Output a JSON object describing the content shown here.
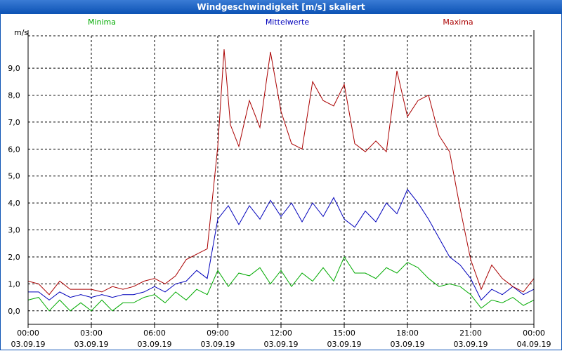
{
  "window": {
    "title": "Windgeschwindigkeit [m/s] skaliert"
  },
  "colors": {
    "min": "#00aa00",
    "mean": "#0000bb",
    "max": "#aa0000",
    "title_bg": "#0c52b4"
  },
  "chart_data": {
    "type": "line",
    "title": "Windgeschwindigkeit [m/s] skaliert",
    "ylabel": "m/s",
    "ylim": [
      -0.5,
      10.2
    ],
    "xlim": [
      0,
      24
    ],
    "grid": true,
    "legend_placement": "top",
    "y_ticks": [
      "0,0",
      "1,0",
      "2,0",
      "3,0",
      "4,0",
      "5,0",
      "6,0",
      "7,0",
      "8,0",
      "9,0"
    ],
    "x_ticks": [
      {
        "time": "00:00",
        "date": "03.09.19"
      },
      {
        "time": "03:00",
        "date": "03.09.19"
      },
      {
        "time": "06:00",
        "date": "03.09.19"
      },
      {
        "time": "09:00",
        "date": "03.09.19"
      },
      {
        "time": "12:00",
        "date": "03.09.19"
      },
      {
        "time": "15:00",
        "date": "03.09.19"
      },
      {
        "time": "18:00",
        "date": "03.09.19"
      },
      {
        "time": "21:00",
        "date": "03.09.19"
      },
      {
        "time": "00:00",
        "date": "04.09.19"
      }
    ],
    "series": [
      {
        "name": "Minima",
        "color": "#00aa00",
        "x": [
          0,
          0.5,
          1,
          1.5,
          2,
          2.5,
          3,
          3.5,
          4,
          4.5,
          5,
          5.5,
          6,
          6.5,
          7,
          7.5,
          8,
          8.5,
          9,
          9.5,
          10,
          10.5,
          11,
          11.5,
          12,
          12.5,
          13,
          13.5,
          14,
          14.5,
          15,
          15.5,
          16,
          16.5,
          17,
          17.5,
          18,
          18.5,
          19,
          19.5,
          20,
          20.5,
          21,
          21.5,
          22,
          22.5,
          23,
          23.5,
          24
        ],
        "values": [
          0.4,
          0.5,
          0.0,
          0.4,
          0.0,
          0.3,
          0.0,
          0.4,
          0.0,
          0.3,
          0.3,
          0.5,
          0.6,
          0.3,
          0.7,
          0.4,
          0.8,
          0.6,
          1.5,
          0.9,
          1.4,
          1.3,
          1.6,
          1.0,
          1.5,
          0.9,
          1.4,
          1.1,
          1.6,
          1.1,
          2.0,
          1.4,
          1.4,
          1.2,
          1.6,
          1.4,
          1.8,
          1.6,
          1.2,
          0.9,
          1.0,
          0.9,
          0.6,
          0.1,
          0.4,
          0.3,
          0.5,
          0.2,
          0.4
        ]
      },
      {
        "name": "Mittelwerte",
        "color": "#0000bb",
        "x": [
          0,
          0.5,
          1,
          1.5,
          2,
          2.5,
          3,
          3.5,
          4,
          4.5,
          5,
          5.5,
          6,
          6.5,
          7,
          7.5,
          8,
          8.5,
          9,
          9.5,
          10,
          10.5,
          11,
          11.5,
          12,
          12.5,
          13,
          13.5,
          14,
          14.5,
          15,
          15.5,
          16,
          16.5,
          17,
          17.5,
          18,
          18.5,
          19,
          19.5,
          20,
          20.5,
          21,
          21.5,
          22,
          22.5,
          23,
          23.5,
          24
        ],
        "values": [
          0.7,
          0.7,
          0.4,
          0.7,
          0.5,
          0.6,
          0.5,
          0.6,
          0.5,
          0.6,
          0.6,
          0.7,
          0.9,
          0.7,
          1.0,
          1.1,
          1.5,
          1.2,
          3.4,
          3.9,
          3.2,
          3.9,
          3.4,
          4.1,
          3.5,
          4.0,
          3.3,
          4.0,
          3.5,
          4.2,
          3.4,
          3.1,
          3.7,
          3.3,
          4.0,
          3.6,
          4.5,
          4.0,
          3.4,
          2.7,
          2.0,
          1.7,
          1.2,
          0.4,
          0.8,
          0.6,
          0.9,
          0.6,
          0.8
        ]
      },
      {
        "name": "Maxima",
        "color": "#aa0000",
        "x": [
          0,
          0.5,
          1,
          1.5,
          2,
          2.5,
          3,
          3.5,
          4,
          4.5,
          5,
          5.5,
          6,
          6.5,
          7,
          7.5,
          8,
          8.5,
          9,
          9.3,
          9.6,
          10,
          10.5,
          11,
          11.5,
          12,
          12.5,
          13,
          13.5,
          14,
          14.5,
          15,
          15.5,
          16,
          16.5,
          17,
          17.5,
          18,
          18.5,
          19,
          19.5,
          20,
          20.5,
          21,
          21.5,
          22,
          22.5,
          23,
          23.5,
          24
        ],
        "values": [
          1.1,
          1.0,
          0.6,
          1.1,
          0.8,
          0.8,
          0.8,
          0.7,
          0.9,
          0.8,
          0.9,
          1.1,
          1.2,
          1.0,
          1.3,
          1.9,
          2.1,
          2.3,
          6.1,
          9.7,
          6.9,
          6.1,
          7.8,
          6.8,
          9.6,
          7.4,
          6.2,
          6.0,
          8.5,
          7.8,
          7.6,
          8.4,
          6.2,
          5.9,
          6.3,
          5.9,
          8.9,
          7.2,
          7.8,
          8.0,
          6.5,
          5.9,
          3.8,
          1.9,
          0.8,
          1.7,
          1.2,
          0.9,
          0.7,
          1.2
        ]
      }
    ]
  }
}
